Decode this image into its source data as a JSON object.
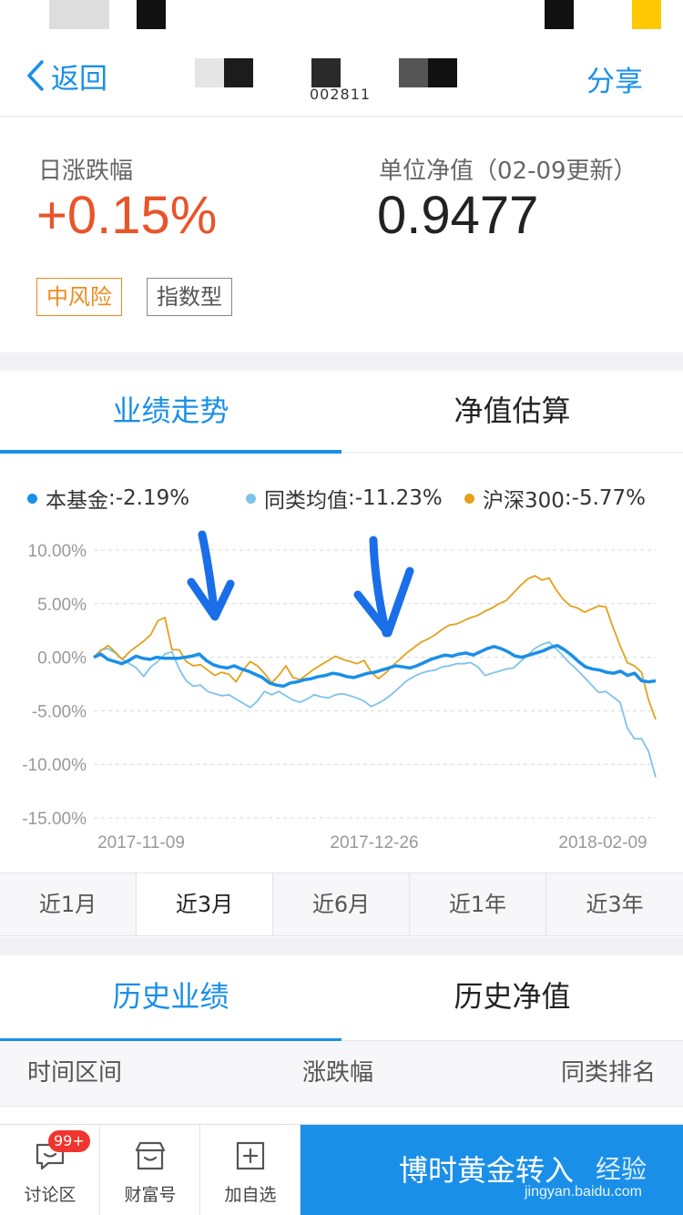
{
  "nav": {
    "back_label": "返回",
    "share_label": "分享",
    "fund_code_partial": "002811"
  },
  "summary": {
    "daily_change_label": "日涨跌幅",
    "daily_change_value": "+0.15%",
    "nav_label": "单位净值（02-09更新）",
    "nav_value": "0.9477",
    "tags": [
      "中风险",
      "指数型"
    ]
  },
  "colors": {
    "accent": "#1a8fe8",
    "up_red": "#e8552a",
    "risk_orange": "#f08a1a",
    "fund_line": "#1a8fe8",
    "peer_line": "#7fc3ec",
    "index_line": "#e3a11b"
  },
  "chart_tabs": [
    {
      "label": "业绩走势",
      "active": true
    },
    {
      "label": "净值估算",
      "active": false
    }
  ],
  "legend": [
    {
      "name": "本基金",
      "value": ":-2.19%"
    },
    {
      "name": "同类均值",
      "value": ":-11.23%"
    },
    {
      "name": "沪深300",
      "value": ":-5.77%"
    }
  ],
  "chart_data": {
    "type": "line",
    "ylim": [
      -15,
      10
    ],
    "yticks": [
      "10.00%",
      "5.00%",
      "0.00%",
      "-5.00%",
      "-10.00%",
      "-15.00%"
    ],
    "xticks": [
      "2017-11-09",
      "2017-12-26",
      "2018-02-09"
    ],
    "grid": true,
    "series": [
      {
        "name": "本基金",
        "values": [
          0,
          0.3,
          -0.2,
          -0.4,
          -0.6,
          -0.3,
          0.1,
          -0.1,
          -0.2,
          0,
          -0.1,
          -0.1,
          -0.1,
          0,
          0.1,
          0.3,
          -0.3,
          -0.7,
          -0.9,
          -1,
          -0.8,
          -1.1,
          -1.3,
          -1.6,
          -1.9,
          -2.4,
          -2.6,
          -2.7,
          -2.4,
          -2.3,
          -2.1,
          -2,
          -1.8,
          -1.7,
          -1.5,
          -1.6,
          -1.8,
          -1.9,
          -1.7,
          -1.5,
          -1.4,
          -1.2,
          -1,
          -0.8,
          -0.9,
          -1,
          -0.8,
          -0.5,
          -0.2,
          0,
          0.2,
          0.1,
          0.3,
          0.4,
          0.2,
          0.5,
          0.8,
          1,
          0.8,
          0.5,
          0.1,
          0,
          0.2,
          0.4,
          0.6,
          0.9,
          1.1,
          0.7,
          0.2,
          -0.4,
          -0.9,
          -1.1,
          -1.2,
          -1.4,
          -1.5,
          -1.3,
          -1.7,
          -1.5,
          -2.2,
          -2.3,
          -2.2
        ]
      },
      {
        "name": "同类均值",
        "values": [
          0,
          0.7,
          0.8,
          0.4,
          -0.2,
          -0.6,
          -1,
          -1.8,
          -0.9,
          -0.4,
          0.3,
          0.5,
          -1.1,
          -2.2,
          -2.7,
          -2.6,
          -3.2,
          -3.4,
          -3.6,
          -3.5,
          -3.9,
          -4.3,
          -4.7,
          -4.1,
          -3.2,
          -3.5,
          -3.2,
          -3.6,
          -4,
          -4.2,
          -3.9,
          -3.5,
          -3.7,
          -3.8,
          -3.5,
          -3.4,
          -3.6,
          -3.8,
          -4.1,
          -4.6,
          -4.3,
          -3.9,
          -3.4,
          -2.8,
          -2.2,
          -1.8,
          -1.5,
          -1.3,
          -1.2,
          -0.9,
          -0.8,
          -0.6,
          -0.6,
          -0.5,
          -0.9,
          -1.7,
          -1.5,
          -1.3,
          -1.1,
          -1,
          -0.4,
          0.2,
          0.8,
          1.2,
          1.4,
          0.8,
          0.1,
          -0.6,
          -1.2,
          -1.9,
          -2.6,
          -3.3,
          -3.2,
          -3.7,
          -4.2,
          -6.6,
          -7.6,
          -7.6,
          -8.8,
          -11.2
        ]
      },
      {
        "name": "沪深300",
        "values": [
          0,
          0.6,
          1.1,
          0.5,
          -0.2,
          0.5,
          1,
          1.5,
          2.1,
          3.4,
          3.7,
          0.7,
          0.7,
          -0.4,
          -0.8,
          -0.7,
          -1.2,
          -1.7,
          -1.4,
          -1.6,
          -2.3,
          -1.2,
          -0.4,
          -0.8,
          -1.5,
          -2.4,
          -1.7,
          -0.8,
          -1.9,
          -2.1,
          -1.6,
          -1.1,
          -0.7,
          -0.3,
          0.1,
          -0.2,
          -0.4,
          -0.6,
          -0.3,
          -1.4,
          -2,
          -1.5,
          -0.8,
          -0.2,
          0.4,
          0.9,
          1.4,
          1.7,
          2.1,
          2.6,
          3,
          3.1,
          3.4,
          3.7,
          3.9,
          4.3,
          4.6,
          5,
          5.3,
          6,
          6.7,
          7.3,
          7.6,
          7.2,
          7.4,
          6.3,
          5.4,
          4.8,
          4.6,
          4.2,
          4.5,
          4.8,
          4.7,
          2.8,
          1.1,
          -0.5,
          -0.8,
          -1.4,
          -4,
          -5.8
        ]
      }
    ]
  },
  "range_tabs": [
    {
      "label": "近1月",
      "active": false
    },
    {
      "label": "近3月",
      "active": true
    },
    {
      "label": "近6月",
      "active": false
    },
    {
      "label": "近1年",
      "active": false
    },
    {
      "label": "近3年",
      "active": false
    }
  ],
  "history_tabs": [
    {
      "label": "历史业绩",
      "active": true
    },
    {
      "label": "历史净值",
      "active": false
    }
  ],
  "table_headers": [
    "时间区间",
    "涨跌幅",
    "同类排名"
  ],
  "bottom_bar": {
    "items": [
      {
        "label": "讨论区",
        "badge": "99+",
        "icon": "chat-icon"
      },
      {
        "label": "财富号",
        "icon": "shop-icon"
      },
      {
        "label": "加自选",
        "icon": "add-watchlist-icon"
      }
    ],
    "buy_label": "博时黄金转入"
  },
  "watermark": {
    "text": "经验",
    "url": "jingyan.baidu.com"
  }
}
